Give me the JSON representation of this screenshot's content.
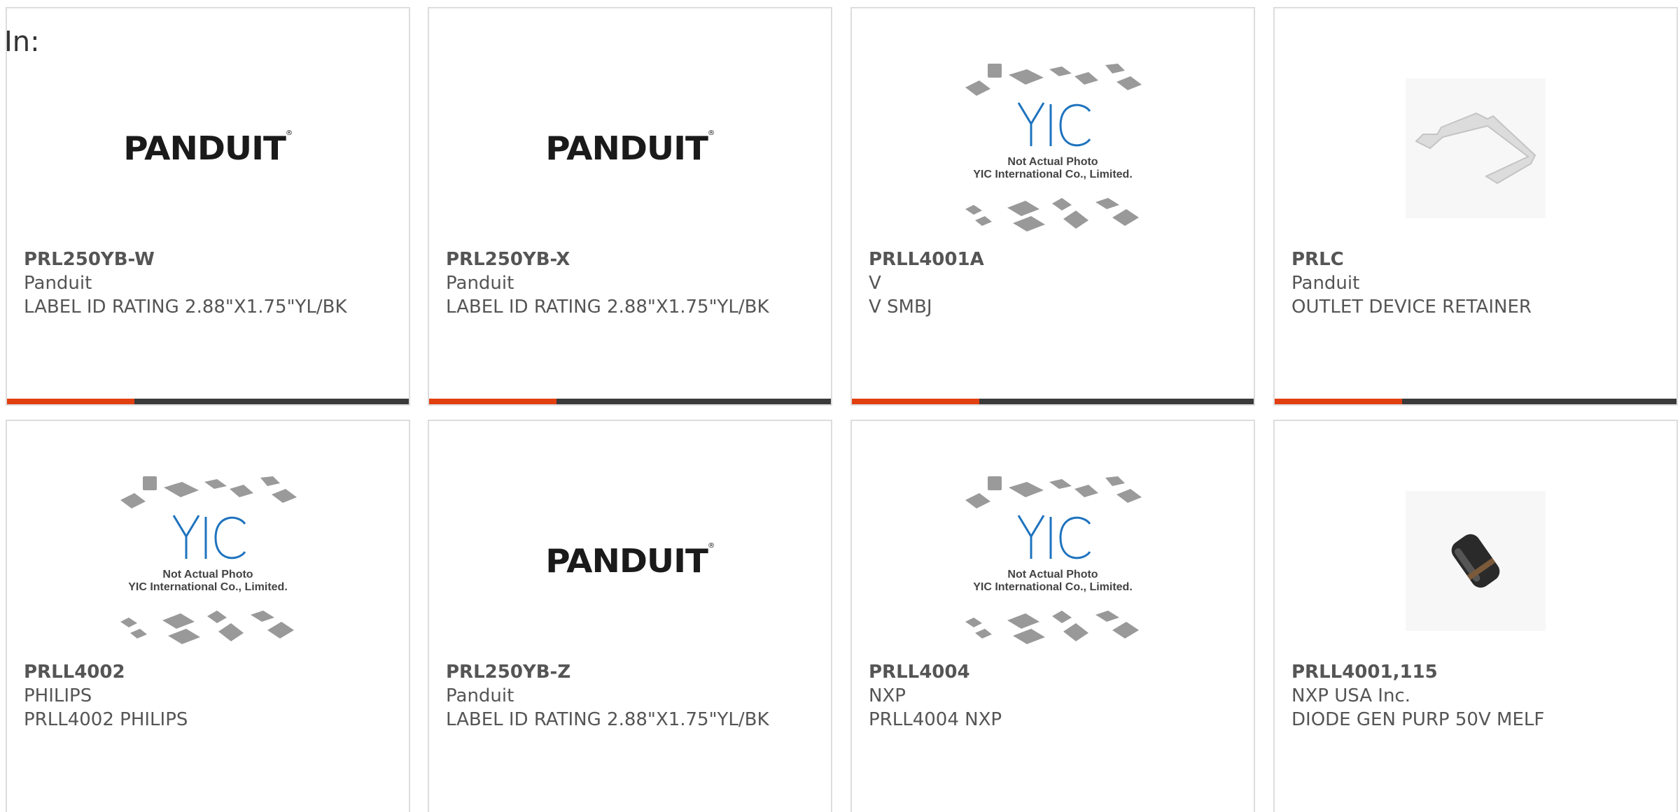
{
  "filter": {
    "label": "In:"
  },
  "cards": [
    {
      "part_number": "PRL250YB-W",
      "manufacturer": "Panduit",
      "description": "LABEL ID RATING 2.88\"X1.75\"YL/BK",
      "image": "panduit-logo"
    },
    {
      "part_number": "PRL250YB-X",
      "manufacturer": "Panduit",
      "description": "LABEL ID RATING 2.88\"X1.75\"YL/BK",
      "image": "panduit-logo"
    },
    {
      "part_number": "PRLL4001A",
      "manufacturer": "V",
      "description": "V SMBJ",
      "image": "yic-placeholder"
    },
    {
      "part_number": "PRLC",
      "manufacturer": "Panduit",
      "description": "OUTLET DEVICE RETAINER",
      "image": "retainer-photo"
    },
    {
      "part_number": "PRLL4002",
      "manufacturer": "PHILIPS",
      "description": "PRLL4002 PHILIPS",
      "image": "yic-placeholder"
    },
    {
      "part_number": "PRL250YB-Z",
      "manufacturer": "Panduit",
      "description": "LABEL ID RATING 2.88\"X1.75\"YL/BK",
      "image": "panduit-logo"
    },
    {
      "part_number": "PRLL4004",
      "manufacturer": "NXP",
      "description": "PRLL4004 NXP",
      "image": "yic-placeholder"
    },
    {
      "part_number": "PRLL4001,115",
      "manufacturer": "NXP USA Inc.",
      "description": "DIODE GEN PURP 50V MELF",
      "image": "diode-photo"
    }
  ],
  "logos": {
    "panduit": "PANDUIT",
    "yic_line1": "Not Actual Photo",
    "yic_line2": "YIC International Co., Limited."
  },
  "colors": {
    "accent": "#e23f10",
    "bar": "#3a3a3a",
    "text": "#555555",
    "yic_blue": "#1e73be"
  }
}
